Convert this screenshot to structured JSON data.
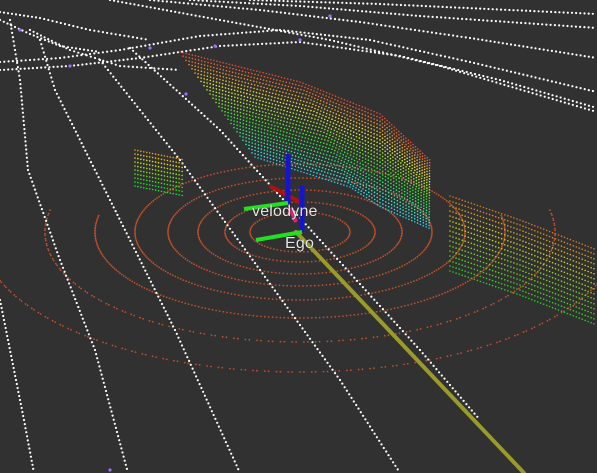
{
  "frames": {
    "velodyne": "velodyne",
    "ego": "Ego"
  },
  "colors": {
    "background": "#313131",
    "lane_points": "#ffffff",
    "ring_points": "#c0502a",
    "path_line": "#9a9a2a",
    "axis_x": "#e01010",
    "axis_y": "#10e010",
    "axis_z": "#1010e0",
    "marker": "#e0207a",
    "highlight_points": "#9a6cff"
  },
  "icons": [
    "tf-axes-icon"
  ]
}
